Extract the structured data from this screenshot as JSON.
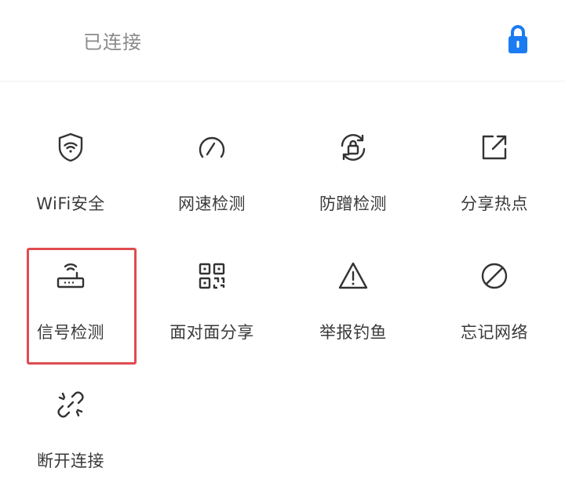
{
  "header": {
    "status": "已连接",
    "lock_color": "#1a7cf2"
  },
  "grid": {
    "items": [
      {
        "label": "WiFi安全",
        "icon": "wifi-shield-icon"
      },
      {
        "label": "网速检测",
        "icon": "speedometer-icon"
      },
      {
        "label": "防蹭检测",
        "icon": "anti-leech-lock-icon"
      },
      {
        "label": "分享热点",
        "icon": "share-external-icon"
      },
      {
        "label": "信号检测",
        "icon": "router-signal-icon"
      },
      {
        "label": "面对面分享",
        "icon": "qr-code-icon"
      },
      {
        "label": "举报钓鱼",
        "icon": "warning-triangle-icon"
      },
      {
        "label": "忘记网络",
        "icon": "forbidden-circle-icon"
      },
      {
        "label": "断开连接",
        "icon": "broken-link-icon"
      }
    ]
  },
  "colors": {
    "highlight": "#e04b50",
    "text": "#333333"
  }
}
